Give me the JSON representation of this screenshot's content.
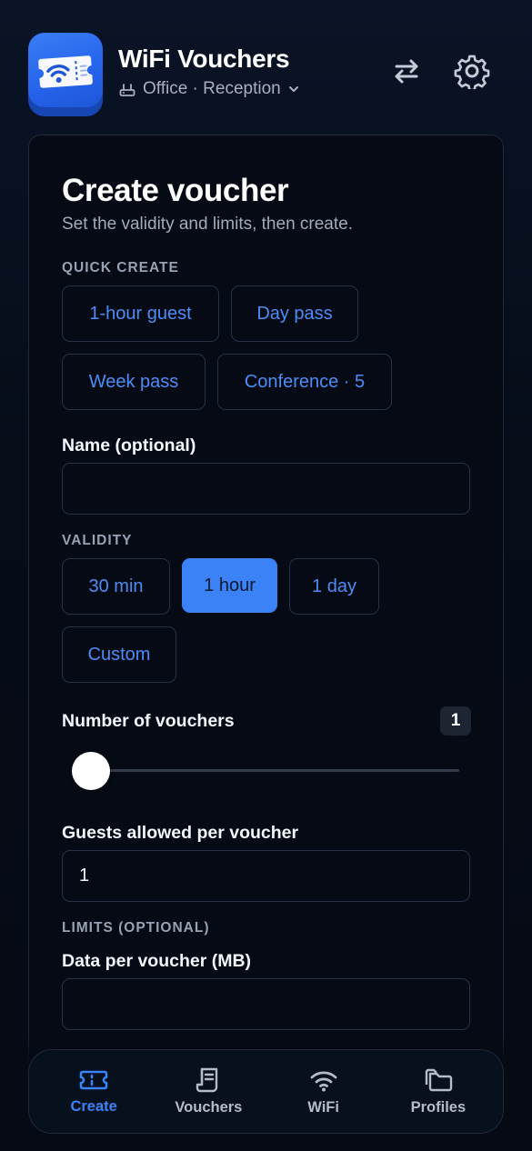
{
  "header": {
    "app_title": "WiFi Vouchers",
    "site_label": "Office · Reception",
    "icons": {
      "app": "wifi-ticket-icon",
      "site": "router-icon",
      "site_dropdown": "chevron-down-icon",
      "switch": "swap-arrows-icon",
      "settings": "gear-icon"
    }
  },
  "card": {
    "title": "Create voucher",
    "subtitle": "Set the validity and limits, then create.",
    "quick_create": {
      "label": "QUICK CREATE",
      "presets": [
        "1-hour guest",
        "Day pass",
        "Week pass",
        "Conference · 5"
      ]
    },
    "name_field": {
      "label": "Name (optional)",
      "value": "",
      "placeholder": ""
    },
    "validity": {
      "label": "VALIDITY",
      "options": [
        "30 min",
        "1 hour",
        "1 day",
        "Custom"
      ],
      "selected": "1 hour"
    },
    "vouchers": {
      "label": "Number of vouchers",
      "count": "1",
      "slider_value": 1
    },
    "guests": {
      "label": "Guests allowed per voucher",
      "value": "1"
    },
    "limits": {
      "label": "LIMITS (OPTIONAL)",
      "data_label": "Data per voucher (MB)",
      "data_value": ""
    }
  },
  "nav": {
    "items": [
      {
        "label": "Create",
        "icon": "ticket-icon",
        "active": true
      },
      {
        "label": "Vouchers",
        "icon": "receipt-icon",
        "active": false
      },
      {
        "label": "WiFi",
        "icon": "wifi-icon",
        "active": false
      },
      {
        "label": "Profiles",
        "icon": "folders-icon",
        "active": false
      }
    ]
  },
  "colors": {
    "accent": "#3b82f6",
    "background": "#050a14",
    "border": "#263244"
  }
}
